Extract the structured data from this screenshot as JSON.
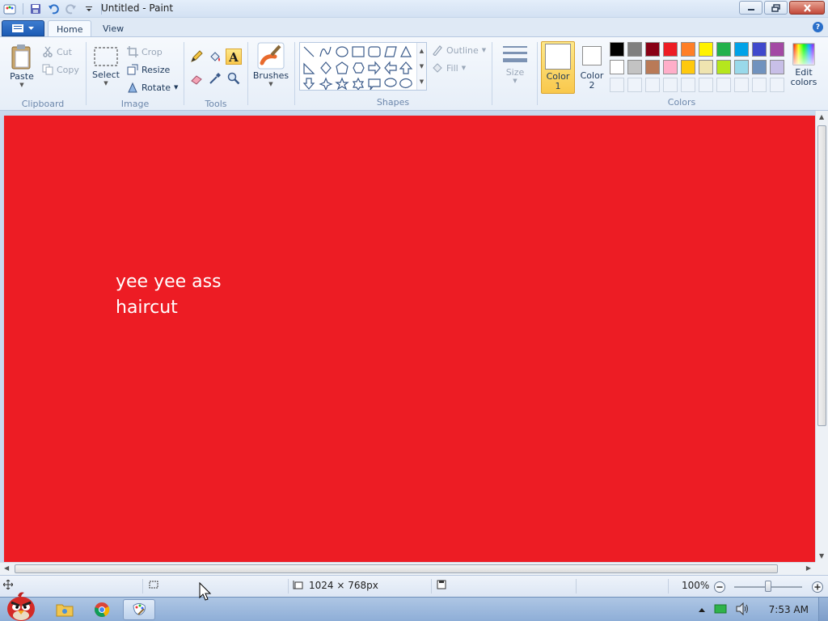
{
  "window": {
    "title": "Untitled - Paint"
  },
  "ribbon": {
    "tabs": [
      {
        "label": "Home",
        "active": true
      },
      {
        "label": "View",
        "active": false
      }
    ],
    "help_label": "?",
    "clipboard": {
      "group_label": "Clipboard",
      "paste_label": "Paste",
      "cut_label": "Cut",
      "copy_label": "Copy"
    },
    "image": {
      "group_label": "Image",
      "select_label": "Select",
      "crop_label": "Crop",
      "resize_label": "Resize",
      "rotate_label": "Rotate"
    },
    "tools": {
      "group_label": "Tools",
      "active_tool": "text-tool"
    },
    "brushes": {
      "label": "Brushes"
    },
    "shapes": {
      "group_label": "Shapes",
      "outline_label": "Outline",
      "fill_label": "Fill"
    },
    "size": {
      "label": "Size"
    },
    "colors": {
      "group_label": "Colors",
      "color1_label": "Color\n1",
      "color2_label": "Color\n2",
      "color1_value": "#ffffff",
      "color2_value": "#ffffff",
      "edit_colors_label": "Edit\ncolors",
      "palette_row1": [
        "#000000",
        "#7f7f7f",
        "#880015",
        "#ed1c24",
        "#ff7f27",
        "#fff200",
        "#22b14c",
        "#00a2e8",
        "#3f48cc",
        "#a349a4"
      ],
      "palette_row2": [
        "#ffffff",
        "#c3c3c3",
        "#b97a57",
        "#ffaec9",
        "#ffc90e",
        "#efe4b0",
        "#b5e61d",
        "#99d9ea",
        "#7092be",
        "#c8bfe7"
      ]
    }
  },
  "canvas": {
    "background_color": "#ed1c24",
    "text": "yee yee ass\nhaircut",
    "text_color": "#ffffff"
  },
  "statusbar": {
    "dimensions": "1024 × 768px",
    "zoom": "100%"
  },
  "taskbar": {
    "clock": "7:53 AM"
  }
}
